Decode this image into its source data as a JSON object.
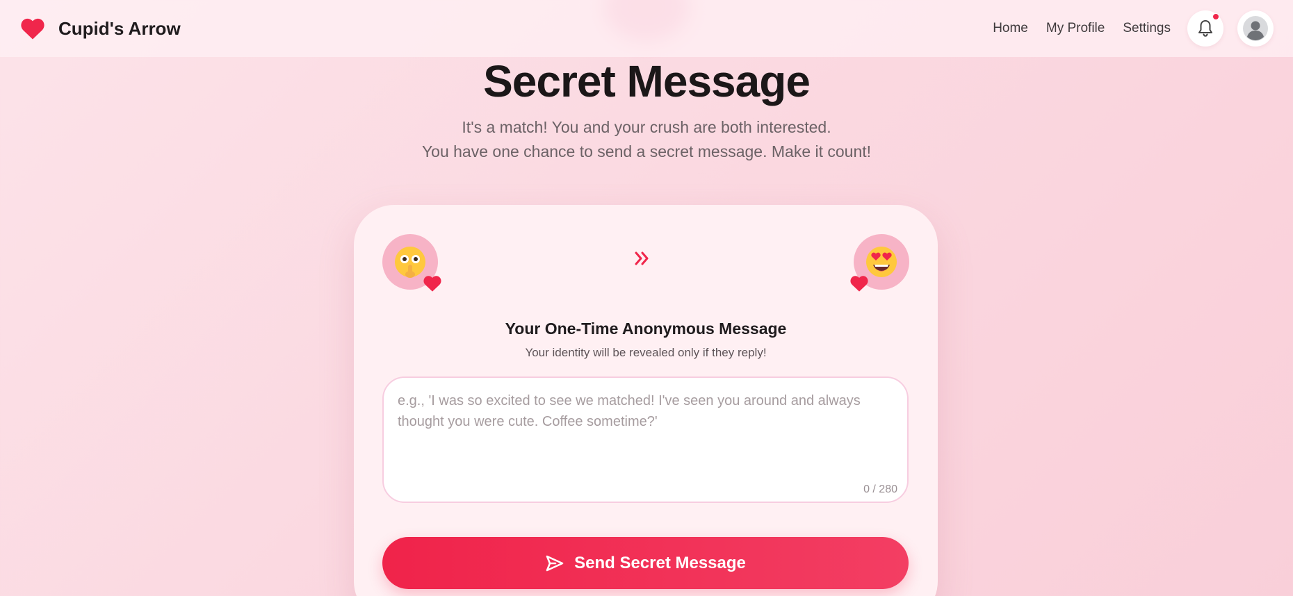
{
  "header": {
    "brand_name": "Cupid's Arrow",
    "nav": [
      {
        "label": "Home"
      },
      {
        "label": "My Profile"
      },
      {
        "label": "Settings"
      }
    ],
    "notification_icon": "bell-icon",
    "avatar_icon": "user-avatar-icon"
  },
  "hero": {
    "title": "Secret Message",
    "subtitle_line1": "It's a match! You and your crush are both interested.",
    "subtitle_line2": "You have one chance to send a secret message. Make it count!"
  },
  "card": {
    "sender_icon": "shushing-face-icon",
    "recipient_icon": "heart-eyes-face-icon",
    "arrow_icon": "double-chevron-right-icon",
    "title": "Your One-Time Anonymous Message",
    "subtitle": "Your identity will be revealed only if they reply!",
    "message": {
      "value": "",
      "placeholder": "e.g., 'I was so excited to see we matched! I've seen you around and always thought you were cute. Coffee sometime?'",
      "counter": "0 / 280"
    },
    "send_label": "Send Secret Message"
  },
  "colors": {
    "accent": "#f0264b",
    "background": "#fbd9e1",
    "card": "#fff0f3"
  }
}
